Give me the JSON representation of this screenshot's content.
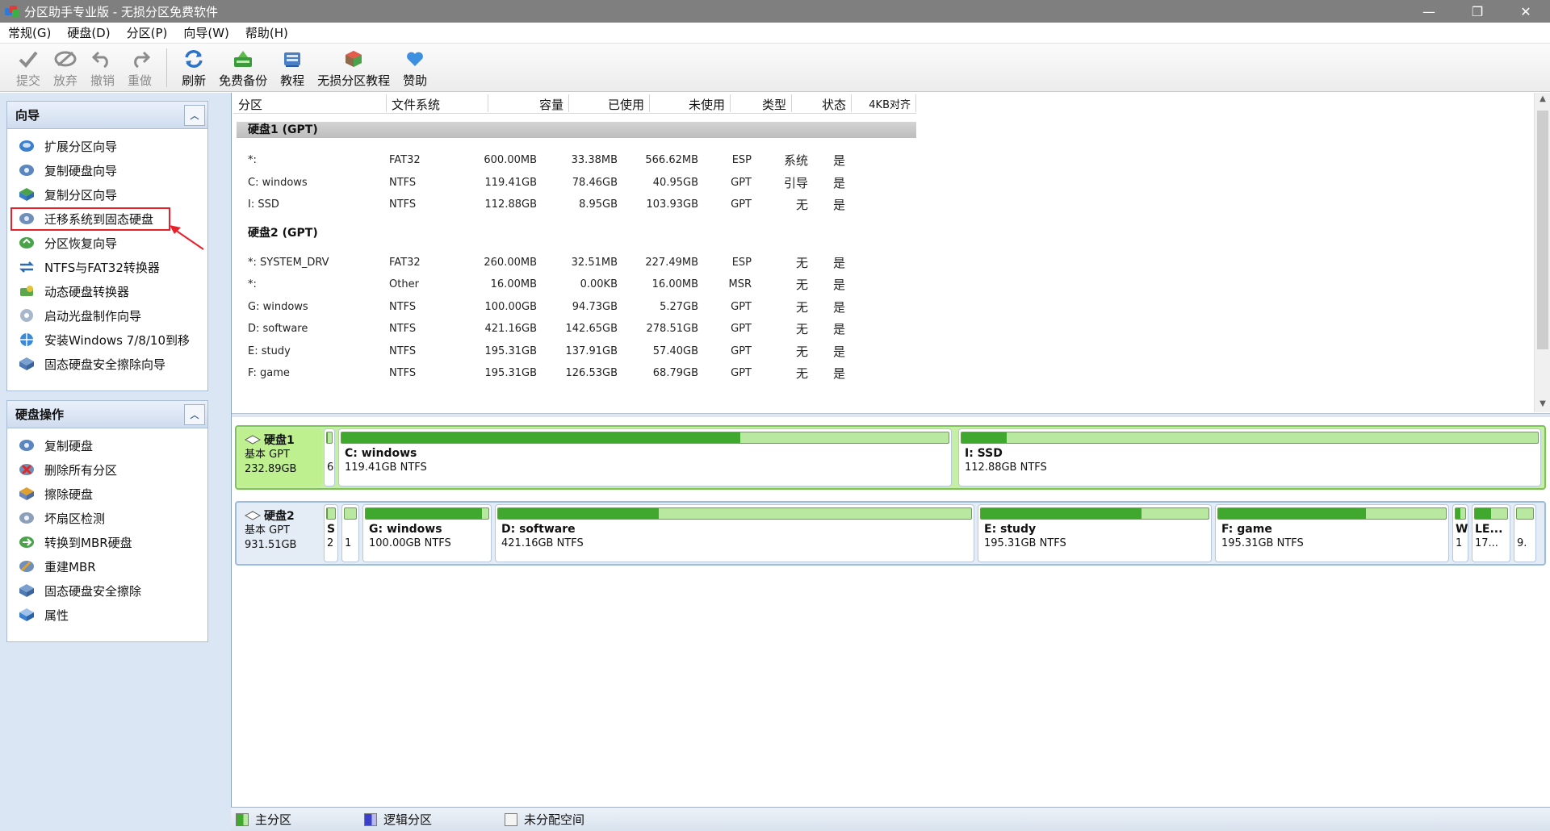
{
  "window": {
    "title": "分区助手专业版 - 无损分区免费软件",
    "controls": [
      "—",
      "❐",
      "✕"
    ]
  },
  "menu": [
    "常规(G)",
    "硬盘(D)",
    "分区(P)",
    "向导(W)",
    "帮助(H)"
  ],
  "toolbar": {
    "left": [
      {
        "label": "提交",
        "icon": "check-icon"
      },
      {
        "label": "放弃",
        "icon": "discard-icon"
      },
      {
        "label": "撤销",
        "icon": "undo-icon"
      },
      {
        "label": "重做",
        "icon": "redo-icon"
      }
    ],
    "right": [
      {
        "label": "刷新",
        "icon": "refresh-icon"
      },
      {
        "label": "免费备份",
        "icon": "backup-icon"
      },
      {
        "label": "教程",
        "icon": "tutorial-icon"
      },
      {
        "label": "无损分区教程",
        "icon": "partition-tutorial-icon"
      },
      {
        "label": "赞助",
        "icon": "heart-icon"
      }
    ]
  },
  "wizard_panel": {
    "title": "向导",
    "items": [
      "扩展分区向导",
      "复制硬盘向导",
      "复制分区向导",
      "迁移系统到固态硬盘",
      "分区恢复向导",
      "NTFS与FAT32转换器",
      "动态硬盘转换器",
      "启动光盘制作向导",
      "安装Windows 7/8/10到移",
      "固态硬盘安全擦除向导"
    ],
    "highlighted_index": 3
  },
  "disk_ops_panel": {
    "title": "硬盘操作",
    "items": [
      "复制硬盘",
      "删除所有分区",
      "擦除硬盘",
      "坏扇区检测",
      "转换到MBR硬盘",
      "重建MBR",
      "固态硬盘安全擦除",
      "属性"
    ]
  },
  "table": {
    "columns": [
      "分区",
      "文件系统",
      "容量",
      "已使用",
      "未使用",
      "类型",
      "状态",
      "4KB对齐"
    ],
    "disks": [
      {
        "title": "硬盘1 (GPT)",
        "rows": [
          [
            "*:",
            "FAT32",
            "600.00MB",
            "33.38MB",
            "566.62MB",
            "ESP",
            "系统",
            "是"
          ],
          [
            "C: windows",
            "NTFS",
            "119.41GB",
            "78.46GB",
            "40.95GB",
            "GPT",
            "引导",
            "是"
          ],
          [
            "I: SSD",
            "NTFS",
            "112.88GB",
            "8.95GB",
            "103.93GB",
            "GPT",
            "无",
            "是"
          ]
        ]
      },
      {
        "title": "硬盘2 (GPT)",
        "rows": [
          [
            "*: SYSTEM_DRV",
            "FAT32",
            "260.00MB",
            "32.51MB",
            "227.49MB",
            "ESP",
            "无",
            "是"
          ],
          [
            "*:",
            "Other",
            "16.00MB",
            "0.00KB",
            "16.00MB",
            "MSR",
            "无",
            "是"
          ],
          [
            "G: windows",
            "NTFS",
            "100.00GB",
            "94.73GB",
            "5.27GB",
            "GPT",
            "无",
            "是"
          ],
          [
            "D: software",
            "NTFS",
            "421.16GB",
            "142.65GB",
            "278.51GB",
            "GPT",
            "无",
            "是"
          ],
          [
            "E: study",
            "NTFS",
            "195.31GB",
            "137.91GB",
            "57.40GB",
            "GPT",
            "无",
            "是"
          ],
          [
            "F: game",
            "NTFS",
            "195.31GB",
            "126.53GB",
            "68.79GB",
            "GPT",
            "无",
            "是"
          ]
        ]
      }
    ]
  },
  "disk_map": [
    {
      "name": "硬盘1",
      "type": "基本 GPT",
      "size": "232.89GB",
      "selected": true,
      "partitions": [
        {
          "name": "",
          "size": "6.",
          "used": 0.06
        },
        {
          "name": "C: windows",
          "size": "119.41GB NTFS",
          "used": 0.657
        },
        {
          "name": "I: SSD",
          "size": "112.88GB NTFS",
          "used": 0.079
        }
      ]
    },
    {
      "name": "硬盘2",
      "type": "基本 GPT",
      "size": "931.51GB",
      "selected": false,
      "partitions": [
        {
          "name": "S",
          "size": "2",
          "used": 0.13
        },
        {
          "name": "",
          "size": "1",
          "used": 0.0
        },
        {
          "name": "G: windows",
          "size": "100.00GB NTFS",
          "used": 0.947
        },
        {
          "name": "D: software",
          "size": "421.16GB NTFS",
          "used": 0.339
        },
        {
          "name": "E: study",
          "size": "195.31GB NTFS",
          "used": 0.706
        },
        {
          "name": "F: game",
          "size": "195.31GB NTFS",
          "used": 0.648
        },
        {
          "name": "W",
          "size": "1",
          "used": 0.5
        },
        {
          "name": "LE...",
          "size": "17...",
          "used": 0.5
        },
        {
          "name": "",
          "size": "9.",
          "used": 0.0
        }
      ]
    }
  ],
  "status_legend": [
    {
      "label": "主分区",
      "color": "#41a82f"
    },
    {
      "label": "逻辑分区",
      "color": "#3b40c8"
    },
    {
      "label": "未分配空间",
      "color": "#f4f4f4"
    }
  ],
  "colors": {
    "primary": "#41a82f",
    "primary_light": "#b9e8a0",
    "logical": "#3b40c8",
    "selected_disk": "#bff08f",
    "highlight": "#e8202a"
  }
}
